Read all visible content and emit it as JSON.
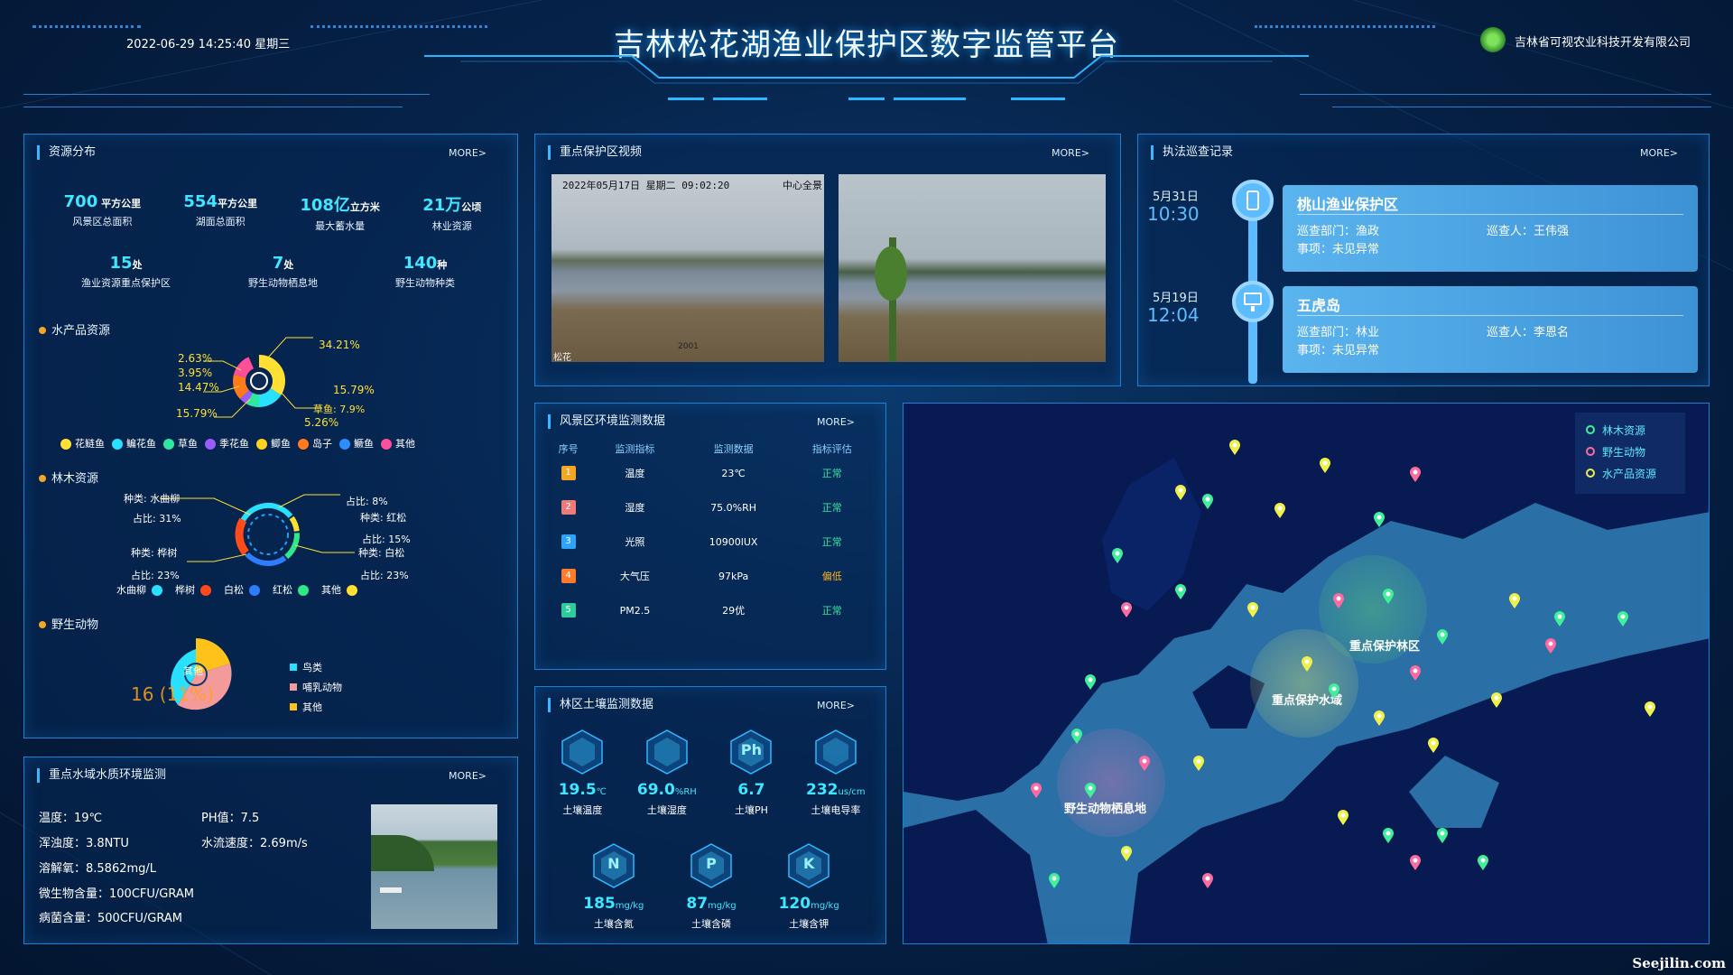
{
  "header": {
    "datetime": "2022-06-29 14:25:40 星期三",
    "title": "吉林松花湖渔业保护区数字监管平台",
    "company": "吉林省可视农业科技开发有限公司"
  },
  "resource": {
    "title": "资源分布",
    "more": "MORE>",
    "stats_row1": [
      {
        "value": "700",
        "unit": " 平方公里",
        "label": "风景区总面积"
      },
      {
        "value": "554",
        "unit": "平方公里",
        "label": "湖面总面积"
      },
      {
        "value": "108亿",
        "unit": "立方米",
        "label": "最大蓄水量"
      },
      {
        "value": "21万",
        "unit": "公顷",
        "label": "林业资源"
      }
    ],
    "stats_row2": [
      {
        "value": "15",
        "unit": "处",
        "label": "渔业资源重点保护区"
      },
      {
        "value": "7",
        "unit": "处",
        "label": "野生动物栖息地"
      },
      {
        "value": "140",
        "unit": "种",
        "label": "野生动物种类"
      }
    ],
    "aquatic": {
      "title": "水产品资源",
      "labels": [
        "2.63%",
        "3.95%",
        "14.47%",
        "15.79%",
        "34.21%",
        "15.79%",
        "草鱼: 7.9%",
        "5.26%"
      ],
      "legend": [
        "花鲢鱼",
        "鳊花鱼",
        "草鱼",
        "季花鱼",
        "鲫鱼",
        "岛子",
        "鳜鱼",
        "其他"
      ],
      "colors": [
        "#ffe033",
        "#27e1ff",
        "#2ee8a0",
        "#9b5cff",
        "#ffd21f",
        "#ff7a1a",
        "#2f8dff",
        "#ff4f9a"
      ]
    },
    "forest": {
      "title": "林木资源",
      "labels": [
        "种类: 水曲柳",
        "占比: 31%",
        "种类: 桦树",
        "占比: 23%",
        "占比: 8%",
        "种类: 红松",
        "占比: 15%",
        "种类: 白松",
        "占比: 23%"
      ],
      "legend": [
        "水曲柳",
        "桦树",
        "白松",
        "红松",
        "其他"
      ],
      "colors": [
        "#27e1ff",
        "#ff4a1a",
        "#2f7dff",
        "#2ee88a",
        "#ffe033"
      ]
    },
    "wildlife": {
      "title": "野生动物",
      "center": "16 (11%)",
      "slice_label": "其他",
      "legend": [
        "鸟类",
        "哺乳动物",
        "其他"
      ],
      "colors": [
        "#27e1ff",
        "#f59a9a",
        "#ffc21a"
      ]
    }
  },
  "water": {
    "title": "重点水域水质环境监测",
    "more": "MORE>",
    "items": [
      "温度：19℃",
      "PH值：7.5",
      "浑浊度：3.8NTU",
      "水流速度：2.69m/s",
      "溶解氧：8.5862mg/L",
      "微生物含量：100CFU/GRAM",
      "病菌含量：500CFU/GRAM"
    ]
  },
  "video": {
    "title": "重点保护区视频",
    "more": "MORE>",
    "cam1_overlay": "2022年05月17日 星期二 09:02:20",
    "cam1_tag": "中心全景",
    "cam1_bottom": "2001",
    "cam1_bl": "松花"
  },
  "env": {
    "title": "风景区环境监测数据",
    "more": "MORE>",
    "headers": [
      "序号",
      "监测指标",
      "监测数据",
      "指标评估"
    ],
    "rows": [
      {
        "i": "1",
        "name": "温度",
        "value": "23℃",
        "eval": "正常",
        "color": "#f5a623",
        "evalColor": "#35e39a"
      },
      {
        "i": "2",
        "name": "湿度",
        "value": "75.0%RH",
        "eval": "正常",
        "color": "#ef7a7a",
        "evalColor": "#35e39a"
      },
      {
        "i": "3",
        "name": "光照",
        "value": "10900lUX",
        "eval": "正常",
        "color": "#2ea4ff",
        "evalColor": "#35e39a"
      },
      {
        "i": "4",
        "name": "大气压",
        "value": "97kPa",
        "eval": "偏低",
        "color": "#ff7a2a",
        "evalColor": "#ffb020"
      },
      {
        "i": "5",
        "name": "PM2.5",
        "value": "29优",
        "eval": "正常",
        "color": "#2ecc9a",
        "evalColor": "#35e39a"
      }
    ]
  },
  "soil": {
    "title": "林区土壤监测数据",
    "more": "MORE>",
    "row1": [
      {
        "v": "19.5",
        "u": "℃",
        "l": "土壤温度",
        "icon": "thermometer-icon"
      },
      {
        "v": "69.0",
        "u": "%RH",
        "l": "土壤湿度",
        "icon": "droplet-icon"
      },
      {
        "v": "6.7",
        "u": "",
        "l": "土壤PH",
        "icon": "ph-icon",
        "glyph": "Ph"
      },
      {
        "v": "232",
        "u": "us/cm",
        "l": "土壤电导率",
        "icon": "lightning-icon"
      }
    ],
    "row2": [
      {
        "v": "185",
        "u": "mg/kg",
        "l": "土壤含氮",
        "icon": "nitrogen-icon",
        "glyph": "N"
      },
      {
        "v": "87",
        "u": "mg/kg",
        "l": "土壤含磷",
        "icon": "phosphorus-icon",
        "glyph": "P"
      },
      {
        "v": "120",
        "u": "mg/kg",
        "l": "土壤含钾",
        "icon": "potassium-icon",
        "glyph": "K"
      }
    ]
  },
  "patrol": {
    "title": "执法巡查记录",
    "more": "MORE>",
    "records": [
      {
        "date": "5月31日",
        "time": "10:30",
        "place": "桃山渔业保护区",
        "dept": "巡查部门：渔政",
        "person": "巡查人：王伟强",
        "event": "事项：未见异常"
      },
      {
        "date": "5月19日",
        "time": "12:04",
        "place": "五虎岛",
        "dept": "巡查部门：林业",
        "person": "巡查人：李恩名",
        "event": "事项：未见异常"
      }
    ]
  },
  "map": {
    "legend": [
      "林木资源",
      "野生动物",
      "水产品资源"
    ],
    "legend_colors": [
      "#3fef9a",
      "#ff6aa0",
      "#f0f04a"
    ],
    "zones": [
      "重点保护林区",
      "重点保护水域",
      "野生动物栖息地"
    ]
  },
  "watermark": "Seejilin.com"
}
